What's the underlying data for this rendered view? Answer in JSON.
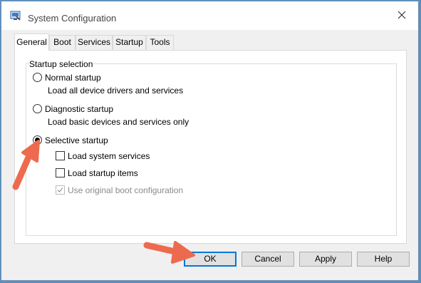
{
  "window": {
    "title": "System Configuration",
    "icon": "system-config-icon",
    "close_icon": "close-icon"
  },
  "tabs": [
    {
      "label": "General",
      "active": true
    },
    {
      "label": "Boot",
      "active": false
    },
    {
      "label": "Services",
      "active": false
    },
    {
      "label": "Startup",
      "active": false
    },
    {
      "label": "Tools",
      "active": false
    }
  ],
  "general": {
    "group_label": "Startup selection",
    "normal": {
      "label": "Normal startup",
      "description": "Load all device drivers and services",
      "selected": false
    },
    "diagnostic": {
      "label": "Diagnostic startup",
      "description": "Load basic devices and services only",
      "selected": false
    },
    "selective": {
      "label": "Selective startup",
      "selected": true,
      "options": [
        {
          "label": "Load system services",
          "checked": false,
          "enabled": true
        },
        {
          "label": "Load startup items",
          "checked": false,
          "enabled": true
        },
        {
          "label": "Use original boot configuration",
          "checked": true,
          "enabled": false
        }
      ]
    }
  },
  "buttons": {
    "ok": "OK",
    "cancel": "Cancel",
    "apply": "Apply",
    "help": "Help"
  },
  "annotation_color": "#ee6a4f"
}
